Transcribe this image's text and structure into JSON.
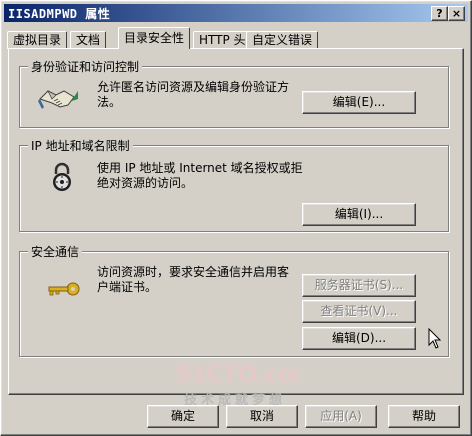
{
  "window": {
    "title": "IISADMPWD 属性"
  },
  "titlebar_buttons": {
    "help": "?",
    "close": "×"
  },
  "tabs": [
    {
      "label": "虚拟目录"
    },
    {
      "label": "文档"
    },
    {
      "label": "目录安全性",
      "active": true
    },
    {
      "label": "HTTP 头"
    },
    {
      "label": "自定义错误"
    }
  ],
  "groups": {
    "auth": {
      "title": "身份验证和访问控制",
      "description": "允许匿名访问资源及编辑身份验证方法。",
      "button": "编辑(E)..."
    },
    "ip": {
      "title": "IP 地址和域名限制",
      "description": "使用 IP 地址或 Internet 域名授权或拒绝对资源的访问。",
      "button": "编辑(I)..."
    },
    "secure": {
      "title": "安全通信",
      "description": "访问资源时，要求安全通信并启用客户端证书。",
      "buttons": {
        "server_cert": "服务器证书(S)...",
        "view_cert": "查看证书(V)...",
        "edit": "编辑(D)..."
      }
    }
  },
  "footer": {
    "ok": "确定",
    "cancel": "取消",
    "apply": "应用(A)",
    "help": "帮助"
  },
  "watermark": {
    "logo": "51CTO.com",
    "tagline": "技术成就梦想"
  }
}
